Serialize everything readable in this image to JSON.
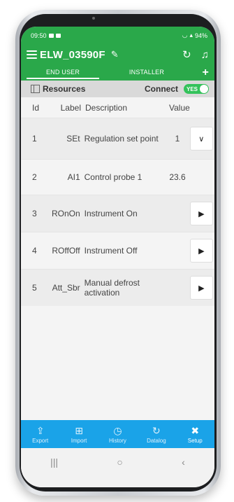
{
  "status_bar": {
    "time": "09:50",
    "battery": "94%"
  },
  "app_bar": {
    "title": "ELW_03590F",
    "edit_icon": "pencil-icon",
    "refresh_icon": "refresh-icon",
    "bell_icon": "bell-icon"
  },
  "tabs": [
    {
      "label": "END USER"
    },
    {
      "label": "INSTALLER"
    }
  ],
  "add_label": "+",
  "resources": {
    "label": "Resources",
    "connect_label": "Connect",
    "toggle_label": "YES"
  },
  "table": {
    "headers": {
      "id": "Id",
      "label": "Label",
      "description": "Description",
      "value": "Value"
    },
    "rows": [
      {
        "id": "1",
        "label": "SEt",
        "description": "Regulation set point",
        "value": "1",
        "action": "chevron-down-icon"
      },
      {
        "id": "2",
        "label": "AI1",
        "description": "Control probe 1",
        "value": "23.6",
        "action": ""
      },
      {
        "id": "3",
        "label": "ROnOn",
        "description": "Instrument On",
        "value": "",
        "action": "play-icon"
      },
      {
        "id": "4",
        "label": "ROffOff",
        "description": "Instrument Off",
        "value": "",
        "action": "play-icon"
      },
      {
        "id": "5",
        "label": "Att_Sbr",
        "description": "Manual defrost activation",
        "value": "",
        "action": "play-icon"
      }
    ]
  },
  "bottom_nav": [
    {
      "label": "Export",
      "icon": "export-icon"
    },
    {
      "label": "Import",
      "icon": "import-icon"
    },
    {
      "label": "History",
      "icon": "history-icon"
    },
    {
      "label": "Datalog",
      "icon": "datalog-icon"
    },
    {
      "label": "Setup",
      "icon": "setup-icon"
    }
  ],
  "colors": {
    "primary": "#2aa84a",
    "nav": "#1aa3e8",
    "toggle": "#33c25a"
  }
}
